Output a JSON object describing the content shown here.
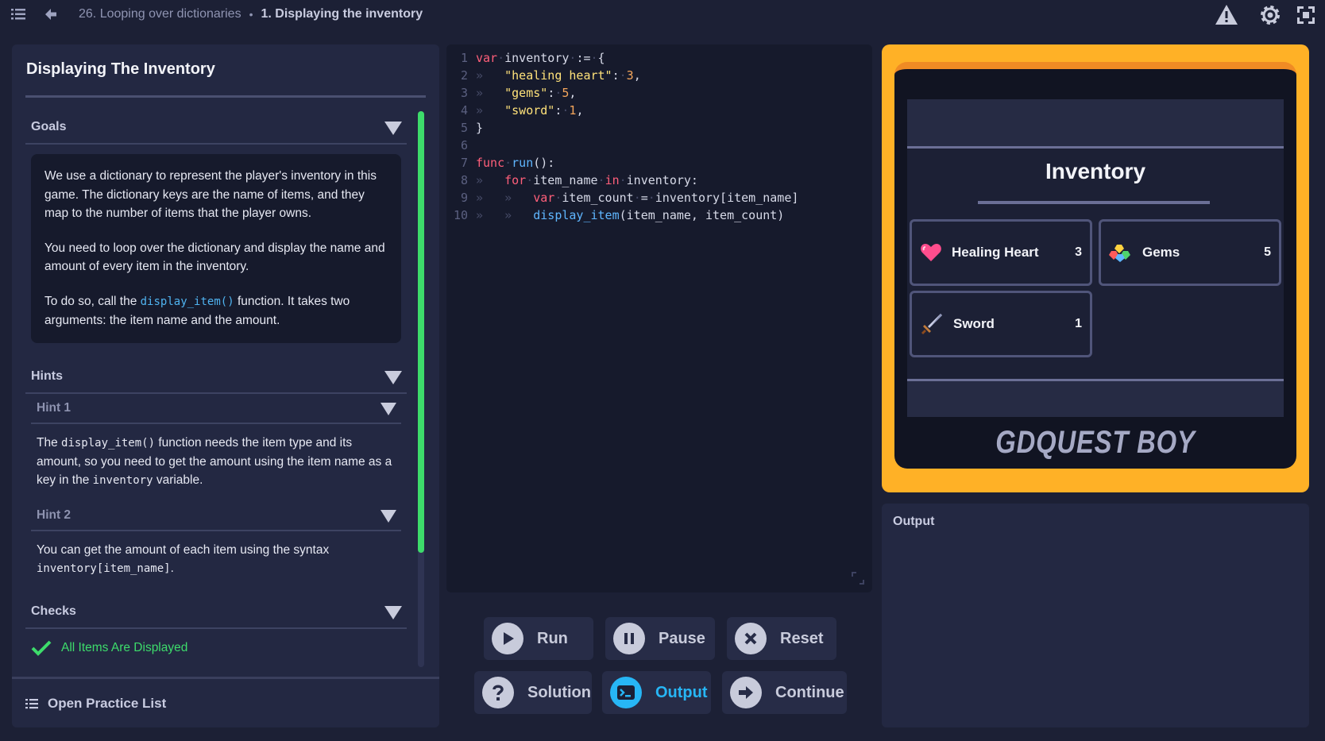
{
  "topbar": {
    "crumb_chapter": "26. Looping over dictionaries",
    "crumb_separator": "•",
    "crumb_lesson": "1. Displaying the inventory"
  },
  "lesson": {
    "title": "Displaying The Inventory",
    "goals": {
      "header": "Goals",
      "p1": "We use a dictionary to represent the player's inventory in this game. The dictionary keys are the name of items, and they map to the number of items that the player owns.",
      "p2": "You need to loop over the dictionary and display the name and amount of every item in the inventory.",
      "p3_before": "To do so, call the ",
      "p3_code": "display_item()",
      "p3_after": " function. It takes two arguments: the item name and the amount."
    },
    "hints": {
      "header": "Hints",
      "hint1": {
        "title": "Hint 1",
        "t1": "The ",
        "c1": "display_item()",
        "t2": " function needs the item type and its amount, so you need to get the amount using the item name as a key in the ",
        "c2": "inventory",
        "t3": " variable."
      },
      "hint2": {
        "title": "Hint 2",
        "t1": "You can get the amount of each item using the syntax ",
        "c1": "inventory[item_name]",
        "t2": "."
      }
    },
    "checks": {
      "header": "Checks",
      "items": [
        "All Items Are Displayed"
      ]
    },
    "practice_list": "Open Practice List"
  },
  "editor": {
    "line_numbers": [
      "1",
      "2",
      "3",
      "4",
      "5",
      "6",
      "7",
      "8",
      "9",
      "10"
    ],
    "tokens": {
      "var": "var",
      "inventory": "inventory",
      "assign": ":=",
      "open_brace": "{",
      "close_brace": "}",
      "k1": "\"healing heart\"",
      "v1": "3",
      "k2": "\"gems\"",
      "v2": "5",
      "k3": "\"sword\"",
      "v3": "1",
      "colon": ":",
      "comma": ",",
      "func": "func",
      "run": "run",
      "run_tail": "():",
      "for": "for",
      "item_name": "item_name",
      "in": "in",
      "inventory_colon": "inventory:",
      "item_count": "item_count",
      "eq": "=",
      "lookup": "inventory[item_name]",
      "display_item": "display_item",
      "call_args": "(item_name, item_count)"
    }
  },
  "buttons": {
    "run": "Run",
    "pause": "Pause",
    "reset": "Reset",
    "solution": "Solution",
    "output": "Output",
    "continue": "Continue"
  },
  "game": {
    "title": "Inventory",
    "items": [
      {
        "name": "Healing Heart",
        "count": "3",
        "icon": "heart-icon"
      },
      {
        "name": "Gems",
        "count": "5",
        "icon": "gems-icon"
      },
      {
        "name": "Sword",
        "count": "1",
        "icon": "sword-icon"
      }
    ],
    "brand": "GDQUEST BOY"
  },
  "output_panel": {
    "label": "Output"
  },
  "colors": {
    "accent_green": "#3ddc6b",
    "accent_blue": "#27b6f5",
    "frame_orange": "#ffb126"
  }
}
